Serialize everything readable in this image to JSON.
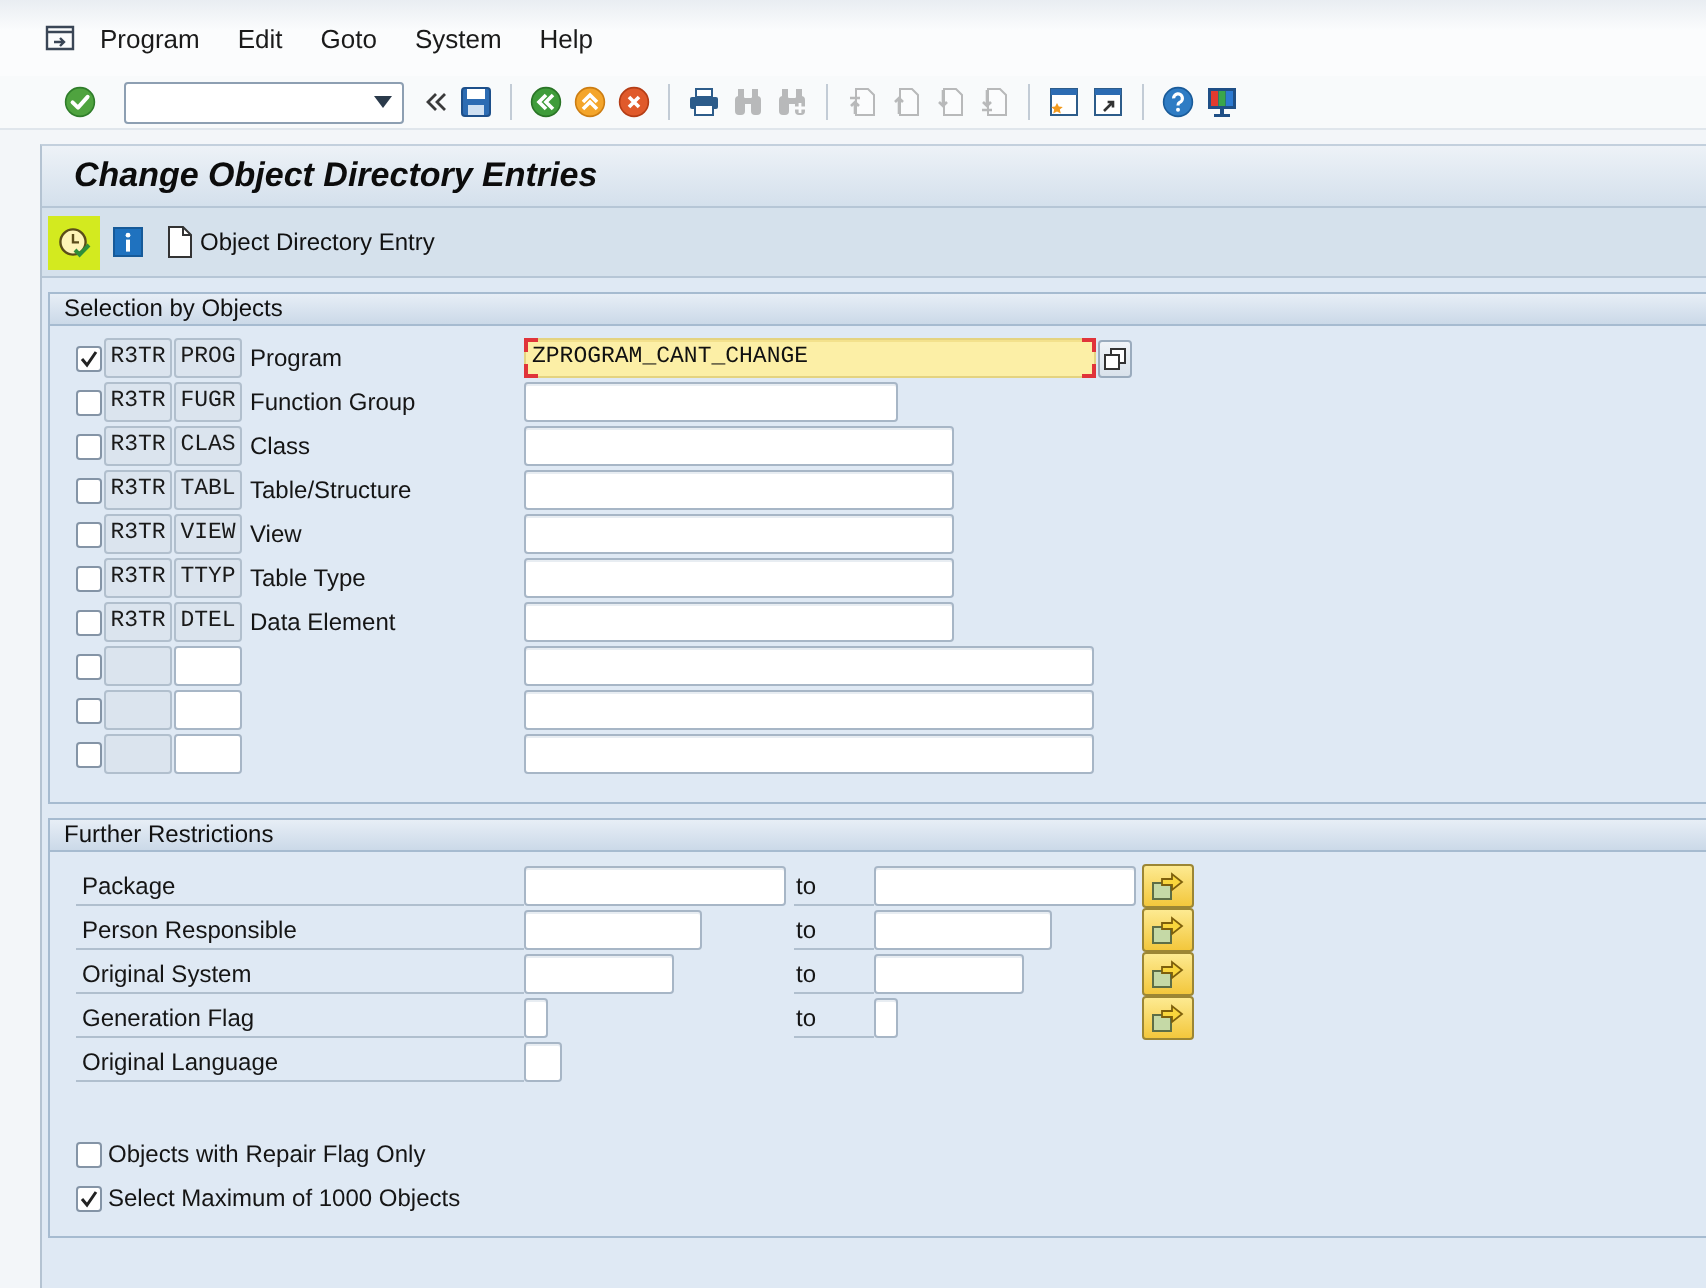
{
  "menu_bar": {
    "items": [
      "Program",
      "Edit",
      "Goto",
      "System",
      "Help"
    ]
  },
  "toolbar": {
    "items": [
      {
        "kind": "enter",
        "disabled": false
      },
      {
        "kind": "command_field"
      },
      {
        "kind": "collapse",
        "disabled": false
      },
      {
        "kind": "save",
        "disabled": false
      },
      {
        "kind": "separator"
      },
      {
        "kind": "back",
        "disabled": false
      },
      {
        "kind": "exit",
        "disabled": false
      },
      {
        "kind": "cancel",
        "disabled": false
      },
      {
        "kind": "separator"
      },
      {
        "kind": "print",
        "disabled": false
      },
      {
        "kind": "find",
        "disabled": true
      },
      {
        "kind": "find_next",
        "disabled": true
      },
      {
        "kind": "separator"
      },
      {
        "kind": "first_page",
        "disabled": true
      },
      {
        "kind": "previous_page",
        "disabled": true
      },
      {
        "kind": "next_page",
        "disabled": true
      },
      {
        "kind": "last_page",
        "disabled": true
      },
      {
        "kind": "separator"
      },
      {
        "kind": "new_session",
        "disabled": false
      },
      {
        "kind": "shortcut",
        "disabled": false
      },
      {
        "kind": "separator"
      },
      {
        "kind": "help",
        "disabled": false
      },
      {
        "kind": "layout",
        "disabled": false
      }
    ]
  },
  "title": "Change Object Directory Entries",
  "app_toolbar": {
    "items": [
      {
        "kind": "execute",
        "highlighted": true
      },
      {
        "kind": "info"
      },
      {
        "kind": "document",
        "label": "Object Directory Entry"
      }
    ]
  },
  "selection": {
    "title": "Selection by Objects",
    "rows": [
      {
        "kind": "preset",
        "checked": true,
        "pgmid": "R3TR",
        "object_type": "PROG",
        "label": "Program",
        "value": "ZPROGRAM_CANT_CHANGE",
        "focused": true
      },
      {
        "kind": "preset",
        "checked": false,
        "pgmid": "R3TR",
        "object_type": "FUGR",
        "label": "Function Group",
        "focused": false
      },
      {
        "kind": "preset",
        "checked": false,
        "pgmid": "R3TR",
        "object_type": "CLAS",
        "label": "Class",
        "focused": false
      },
      {
        "kind": "preset",
        "checked": false,
        "pgmid": "R3TR",
        "object_type": "TABL",
        "label": "Table/Structure",
        "focused": false
      },
      {
        "kind": "preset",
        "checked": false,
        "pgmid": "R3TR",
        "object_type": "VIEW",
        "label": "View",
        "focused": false
      },
      {
        "kind": "preset",
        "checked": false,
        "pgmid": "R3TR",
        "object_type": "TTYP",
        "label": "Table Type",
        "focused": false
      },
      {
        "kind": "preset",
        "checked": false,
        "pgmid": "R3TR",
        "object_type": "DTEL",
        "label": "Data Element",
        "focused": false
      },
      {
        "kind": "custom",
        "checked": false,
        "focused": false
      },
      {
        "kind": "custom",
        "checked": false,
        "focused": false
      },
      {
        "kind": "custom",
        "checked": false,
        "focused": false
      }
    ]
  },
  "restrictions": {
    "title": "Further Restrictions",
    "rows": [
      {
        "label": "Package",
        "to": "to"
      },
      {
        "label": "Person Responsible",
        "to": "to"
      },
      {
        "label": "Original System",
        "to": "to"
      },
      {
        "label": "Generation Flag",
        "to": "to"
      },
      {
        "label": "Original Language"
      }
    ],
    "options": [
      {
        "label": "Objects with Repair Flag Only",
        "checked": false
      },
      {
        "label": "Select Maximum of 1000 Objects",
        "checked": true
      }
    ]
  }
}
